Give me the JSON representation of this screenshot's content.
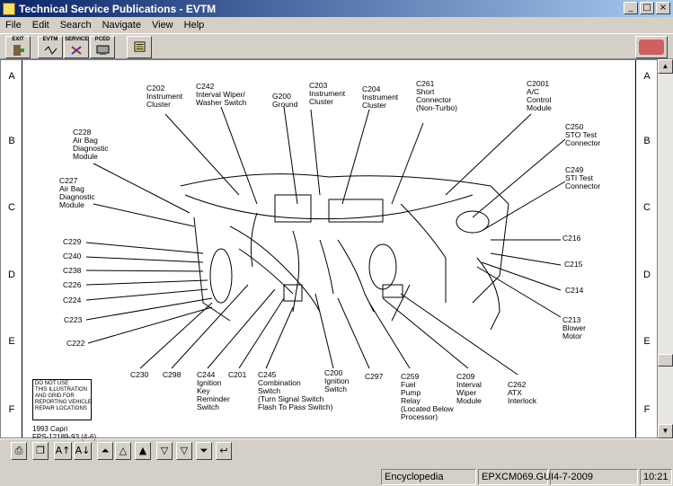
{
  "window": {
    "title": "Technical Service Publications - EVTM",
    "controls": {
      "minimize": "_",
      "maximize": "□",
      "close": "×"
    }
  },
  "menu": [
    "File",
    "Edit",
    "Search",
    "Navigate",
    "View",
    "Help"
  ],
  "toolbar": {
    "exit_label": "EXIT",
    "evtm_label": "EVTM",
    "service_label": "SERVICE",
    "pced_label": "PCED"
  },
  "ruler": {
    "rows": [
      "A",
      "B",
      "C",
      "D",
      "E",
      "F"
    ]
  },
  "callouts": [
    {
      "id": "c202",
      "text": "C202\nInstrument\nCluster"
    },
    {
      "id": "c242",
      "text": "C242\nInterval Wiper/\nWasher Switch"
    },
    {
      "id": "g200",
      "text": "G200\nGround"
    },
    {
      "id": "c203",
      "text": "C203\nInstrument\nCluster"
    },
    {
      "id": "c204",
      "text": "C204\nInstrument\nCluster"
    },
    {
      "id": "c261",
      "text": "C261\nShort\nConnector\n(Non-Turbo)"
    },
    {
      "id": "c2001",
      "text": "C2001\nA/C\nControl\nModule"
    },
    {
      "id": "c250",
      "text": "C250\nSTO Test\nConnector"
    },
    {
      "id": "c249",
      "text": "C249\nSTI Test\nConnector"
    },
    {
      "id": "c228",
      "text": "C228\nAir Bag\nDiagnostic\nModule"
    },
    {
      "id": "c227",
      "text": "C227\nAir Bag\nDiagnostic\nModule"
    },
    {
      "id": "c229",
      "text": "C229"
    },
    {
      "id": "c240",
      "text": "C240"
    },
    {
      "id": "c238",
      "text": "C238"
    },
    {
      "id": "c226",
      "text": "C226"
    },
    {
      "id": "c224",
      "text": "C224"
    },
    {
      "id": "c223",
      "text": "C223"
    },
    {
      "id": "c222",
      "text": "C222"
    },
    {
      "id": "c216",
      "text": "C216"
    },
    {
      "id": "c215",
      "text": "C215"
    },
    {
      "id": "c214",
      "text": "C214"
    },
    {
      "id": "c213",
      "text": "C213\nBlower\nMotor"
    },
    {
      "id": "c230",
      "text": "C230"
    },
    {
      "id": "c298",
      "text": "C298"
    },
    {
      "id": "c244",
      "text": "C244\nIgnition\nKey\nReminder\nSwitch"
    },
    {
      "id": "c201",
      "text": "C201"
    },
    {
      "id": "c245",
      "text": "C245\nCombination\nSwitch\n(Turn Signal Switch\nFlash To Pass Switch)"
    },
    {
      "id": "c200",
      "text": "C200\nIgnition\nSwitch"
    },
    {
      "id": "c297",
      "text": "C297"
    },
    {
      "id": "c259",
      "text": "C259\nFuel\nPump\nRelay\n(Located Below\nProcessor)"
    },
    {
      "id": "c209",
      "text": "C209\nInterval\nWiper\nModule"
    },
    {
      "id": "c262",
      "text": "C262\nATX\nInterlock"
    }
  ],
  "notice": "DO NOT USE\nTHIS ILLUSTRATION\nAND GRID FOR\nREPORTING VEHICLE\nREPAIR LOCATIONS",
  "caption": "1993 Capri\nFPS-12189-93 (4-6)",
  "bottom_buttons": [
    "print-icon",
    "copy-icon",
    "font-larger-icon",
    "font-smaller-icon",
    "first-page-icon",
    "prev-page-icon",
    "next-page-icon",
    "last-page-icon",
    "back-icon"
  ],
  "status": {
    "section": "Encyclopedia",
    "file": "EPXCM069.GUI",
    "date": "4-7-2009",
    "time": "10:21"
  }
}
